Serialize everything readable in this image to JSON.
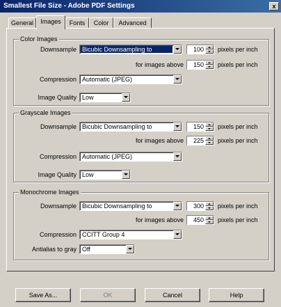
{
  "window": {
    "title": "Smallest File Size - Adobe PDF Settings",
    "close_label": "x"
  },
  "tabs": [
    {
      "label": "General"
    },
    {
      "label": "Images"
    },
    {
      "label": "Fonts"
    },
    {
      "label": "Color"
    },
    {
      "label": "Advanced"
    }
  ],
  "color_images": {
    "title": "Color Images",
    "downsample_label": "Downsample",
    "downsample_value": "Bicubic Downsampling to",
    "resolution": "100",
    "pixels_label": "pixels per inch",
    "above_label": "for images above",
    "above_value": "150",
    "compression_label": "Compression",
    "compression_value": "Automatic (JPEG)",
    "quality_label": "Image Quality",
    "quality_value": "Low"
  },
  "grayscale_images": {
    "title": "Grayscale Images",
    "downsample_label": "Downsample",
    "downsample_value": "Bicubic Downsampling to",
    "resolution": "150",
    "pixels_label": "pixels per inch",
    "above_label": "for images above",
    "above_value": "225",
    "compression_label": "Compression",
    "compression_value": "Automatic (JPEG)",
    "quality_label": "Image Quality",
    "quality_value": "Low"
  },
  "monochrome_images": {
    "title": "Monochrome Images",
    "downsample_label": "Downsample",
    "downsample_value": "Bicubic Downsampling to",
    "resolution": "300",
    "pixels_label": "pixels per inch",
    "above_label": "for images above",
    "above_value": "450",
    "compression_label": "Compression",
    "compression_value": "CCITT Group 4",
    "antialias_label": "Antialias to gray",
    "antialias_value": "Off"
  },
  "buttons": {
    "save_as": "Save As...",
    "ok": "OK",
    "cancel": "Cancel",
    "help": "Help"
  }
}
